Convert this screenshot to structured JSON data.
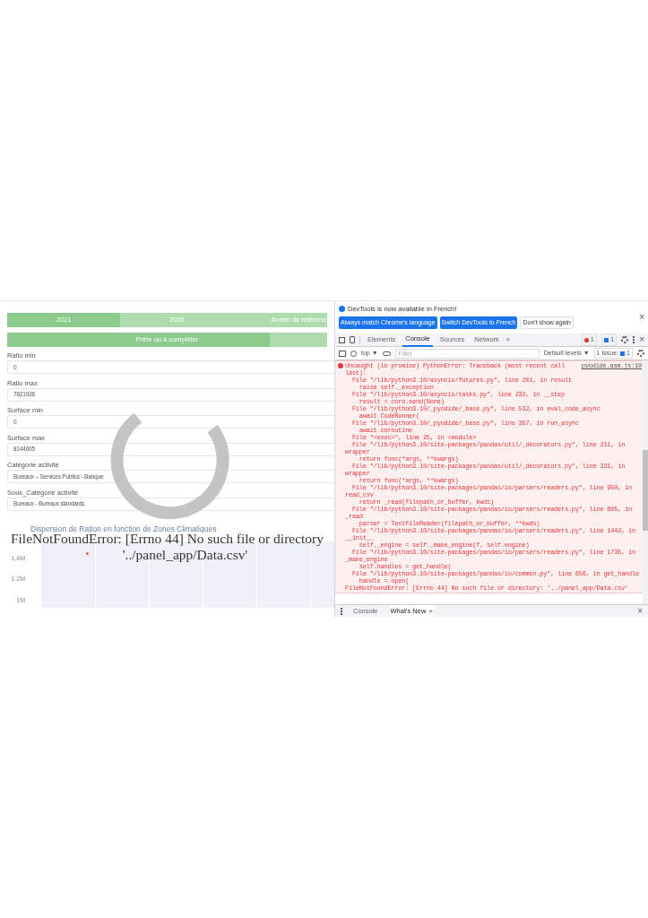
{
  "app": {
    "year_tabs": [
      {
        "label": "2021",
        "selected": true
      },
      {
        "label": "2020",
        "selected": false
      },
      {
        "label": "Année de référenc",
        "selected": false
      }
    ],
    "progress": {
      "label": "Prête ou à compléter",
      "level": 0.82
    },
    "fields": [
      {
        "label": "Ratio min",
        "value": "0"
      },
      {
        "label": "Ratio max",
        "value": "7621936"
      },
      {
        "label": "Surface min",
        "value": "0"
      },
      {
        "label": "Surface max",
        "value": "8144005"
      },
      {
        "label": "Catégorie activité",
        "value": "Bureaux – Services Publics - Banque"
      },
      {
        "label": "Sous_Catégorie activité",
        "value": "Bureaux - Bureaux standards"
      }
    ],
    "chart": {
      "title": "Dispersion de Ration en fonction de Zones Climatiques",
      "y_tick_labels": [
        "1.4M",
        "1.2M",
        "1M"
      ]
    },
    "error_overlay": [
      "FileNotFoundError: [Errno 44] No such file or directory",
      "'../panel_app/Data.csv'"
    ]
  },
  "devtools": {
    "banner": {
      "message": "DevTools is now available in French!",
      "close": "×",
      "buttons": [
        "Always match Chrome's language",
        "Switch DevTools to French"
      ],
      "dismiss": "Don't show again"
    },
    "tabs": [
      {
        "label": "Elements",
        "selected": false
      },
      {
        "label": "Console",
        "selected": true
      },
      {
        "label": "Sources",
        "selected": false
      },
      {
        "label": "Network",
        "selected": false
      }
    ],
    "more_tabs": "»",
    "error_count": "1",
    "message_count": "1",
    "close": "×",
    "context": "top ▼",
    "filter_placeholder": "Filter",
    "levels": "Default levels ▼",
    "issues_label": "1 Issue:",
    "issues_count": "1",
    "source_link": "pyodide.asm.js:10",
    "lines": [
      "Uncaught (in promise) PythonError: Traceback (most recent call",
      "last):",
      "  File \"/lib/python3.10/asyncio/futures.py\", line 201, in result",
      "    raise self._exception",
      "  File \"/lib/python3.10/asyncio/tasks.py\", line 232, in __step",
      "    result = coro.send(None)",
      "  File \"/lib/python3.10/_pyodide/_base.py\", line 532, in eval_code_async",
      "    await CodeRunner(",
      "  File \"/lib/python3.10/_pyodide/_base.py\", line 357, in run_async",
      "    await coroutine",
      "  File \"<exec>\", line 25, in <module>",
      "  File \"/lib/python3.10/site-packages/pandas/util/_decorators.py\", line 211, in",
      "wrapper",
      "    return func(*args, **kwargs)",
      "  File \"/lib/python3.10/site-packages/pandas/util/_decorators.py\", line 331, in",
      "wrapper",
      "    return func(*args, **kwargs)",
      "  File \"/lib/python3.10/site-packages/pandas/io/parsers/readers.py\", line 950, in",
      "read_csv",
      "    return _read(filepath_or_buffer, kwds)",
      "  File \"/lib/python3.10/site-packages/pandas/io/parsers/readers.py\", line 605, in",
      "_read",
      "    parser = TextFileReader(filepath_or_buffer, **kwds)",
      "  File \"/lib/python3.10/site-packages/pandas/io/parsers/readers.py\", line 1442, in",
      "__init__",
      "    self._engine = self._make_engine(f, self.engine)",
      "  File \"/lib/python3.10/site-packages/pandas/io/parsers/readers.py\", line 1735, in",
      "_make_engine",
      "    self.handles = get_handle(",
      "  File \"/lib/python3.10/site-packages/pandas/io/common.py\", line 856, in get_handle",
      "    handle = open(",
      "FileNotFoundError: [Errno 44] No such file or directory: '../panel_app/Data.csv'"
    ],
    "drawer_tabs": [
      {
        "label": "Console",
        "selected": false
      },
      {
        "label": "What's New",
        "selected": true
      }
    ],
    "drawer_tab_close": "×",
    "drawer_close": "×"
  }
}
